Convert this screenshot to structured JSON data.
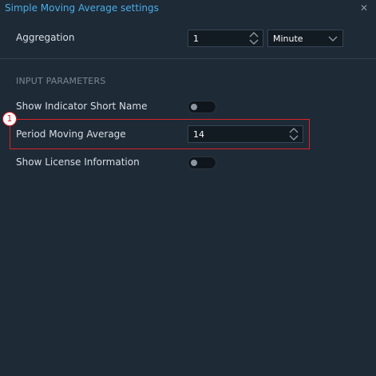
{
  "window": {
    "title": "Simple Moving Average settings",
    "close_icon": "close-icon"
  },
  "aggregation": {
    "label": "Aggregation",
    "value": "1",
    "unit": "Minute"
  },
  "section": {
    "title": "INPUT PARAMETERS"
  },
  "params": {
    "short_name_label": "Show Indicator Short Name",
    "short_name_on": false,
    "period_label": "Period Moving Average",
    "period_value": "14",
    "license_label": "Show License Information",
    "license_on": false
  },
  "annotation": {
    "marker": "1",
    "color": "#d9232a"
  },
  "colors": {
    "background": "#1e2a36",
    "title": "#4aaee8",
    "input_bg": "#121a22"
  }
}
